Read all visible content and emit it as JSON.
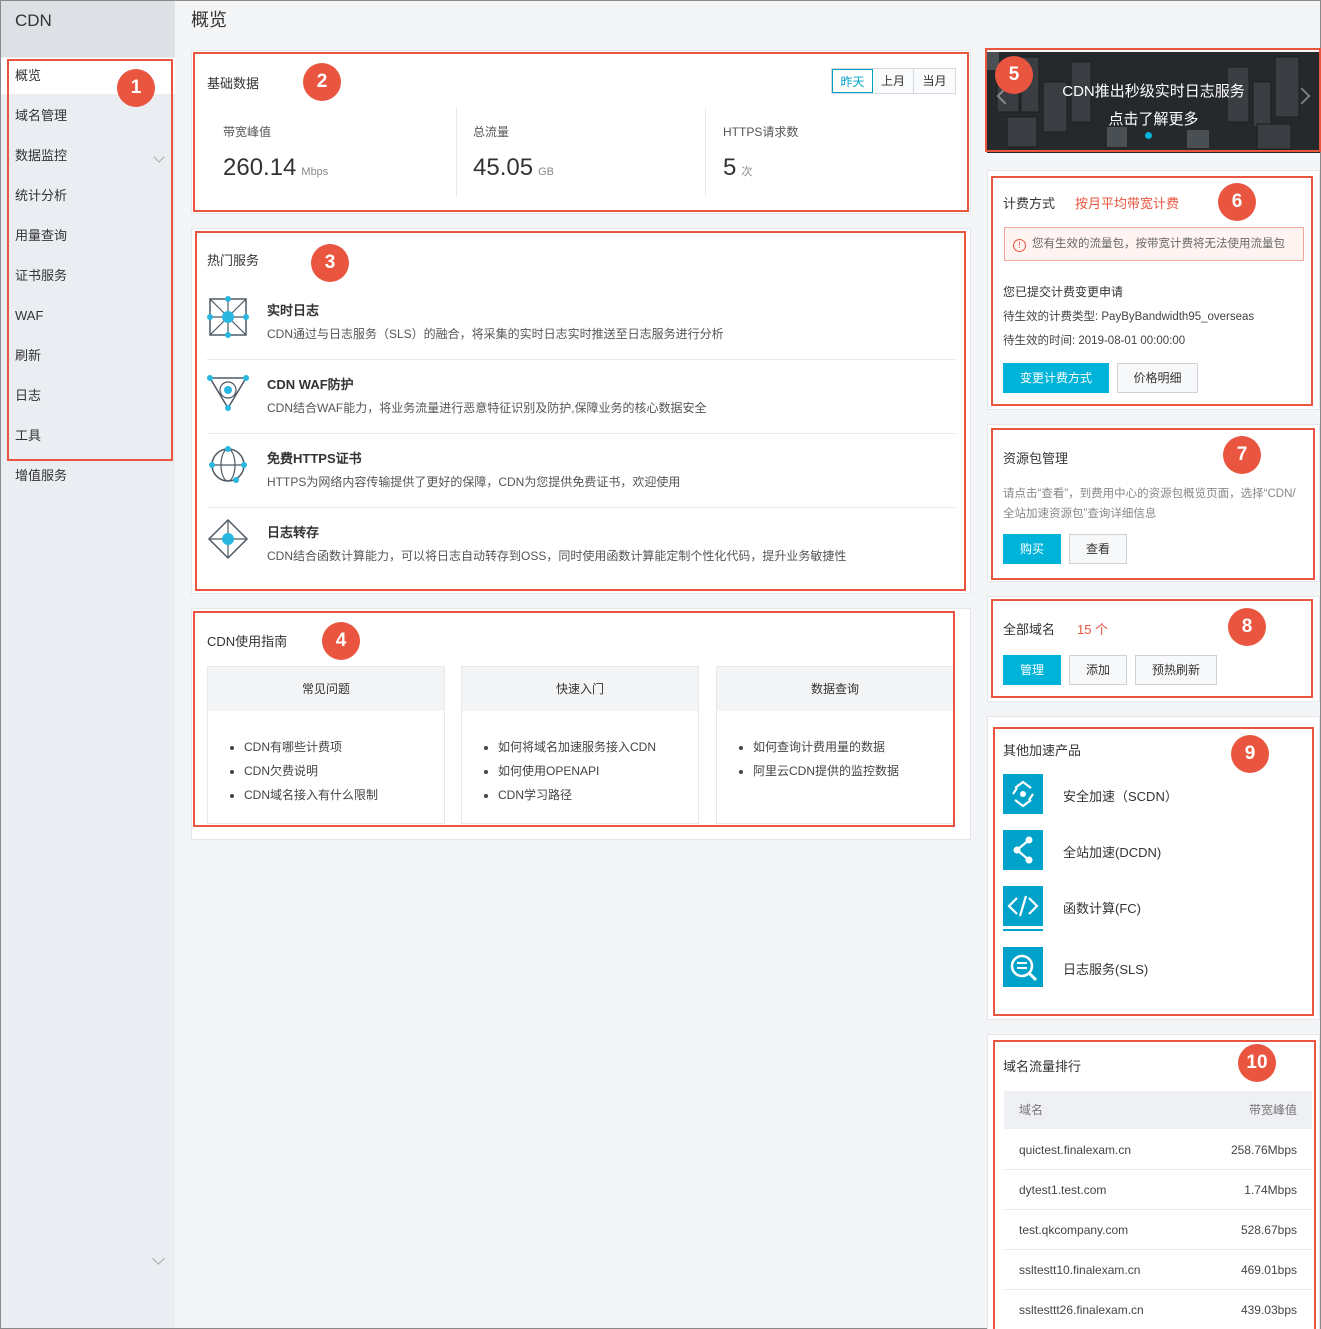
{
  "sidebar": {
    "title": "CDN",
    "items": [
      "概览",
      "域名管理",
      "数据监控",
      "统计分析",
      "用量查询",
      "证书服务",
      "WAF",
      "刷新",
      "日志",
      "工具",
      "增值服务"
    ]
  },
  "page_title": "概览",
  "basic_data": {
    "title": "基础数据",
    "range_options": [
      "昨天",
      "上月",
      "当月"
    ],
    "selected_range": "昨天",
    "stats": [
      {
        "label": "带宽峰值",
        "value": "260.14",
        "unit": "Mbps"
      },
      {
        "label": "总流量",
        "value": "45.05",
        "unit": "GB"
      },
      {
        "label": "HTTPS请求数",
        "value": "5",
        "unit": "次"
      }
    ]
  },
  "hot_services": {
    "title": "热门服务",
    "items": [
      {
        "title": "实时日志",
        "desc": "CDN通过与日志服务（SLS）的融合，将采集的实时日志实时推送至日志服务进行分析",
        "icon": "network-grid-icon"
      },
      {
        "title": "CDN WAF防护",
        "desc": "CDN结合WAF能力，将业务流量进行恶意特征识别及防护,保障业务的核心数据安全",
        "icon": "shield-triangle-icon"
      },
      {
        "title": "免费HTTPS证书",
        "desc": "HTTPS为网络内容传输提供了更好的保障，CDN为您提供免费证书，欢迎使用",
        "icon": "globe-nodes-icon"
      },
      {
        "title": "日志转存",
        "desc": "CDN结合函数计算能力，可以将日志自动转存到OSS，同时使用函数计算能定制个性化代码，提升业务敏捷性",
        "icon": "diamond-nodes-icon"
      }
    ]
  },
  "guide": {
    "title": "CDN使用指南",
    "columns": [
      {
        "header": "常见问题",
        "links": [
          "CDN有哪些计费项",
          "CDN欠费说明",
          "CDN域名接入有什么限制"
        ]
      },
      {
        "header": "快速入门",
        "links": [
          "如何将域名加速服务接入CDN",
          "如何使用OPENAPI",
          "CDN学习路径"
        ]
      },
      {
        "header": "数据查询",
        "links": [
          "如何查询计费用量的数据",
          "阿里云CDN提供的监控数据"
        ]
      }
    ]
  },
  "banner": {
    "line1": "CDN推出秒级实时日志服务",
    "line2": "点击了解更多"
  },
  "billing": {
    "label": "计费方式",
    "method": "按月平均带宽计费",
    "warning": "您有生效的流量包，按带宽计费将无法使用流量包",
    "submitted": "您已提交计费变更申请",
    "pending_type": "待生效的计费类型: PayByBandwidth95_overseas",
    "pending_time": "待生效的时间: 2019-08-01 00:00:00",
    "change_button": "变更计费方式",
    "price_button": "价格明细"
  },
  "resource_pkg": {
    "title": "资源包管理",
    "desc_line1": "请点击“查看”，到费用中心的资源包概览页面，选择“CDN/",
    "desc_line2": "全站加速资源包”查询详细信息",
    "buy_button": "购买",
    "view_button": "查看"
  },
  "domains": {
    "label": "全部域名",
    "count": "15 个",
    "manage_button": "管理",
    "add_button": "添加",
    "refresh_button": "预热刷新"
  },
  "other_products": {
    "title": "其他加速产品",
    "items": [
      {
        "name": "安全加速（SCDN）",
        "icon": "recycle-shield-icon"
      },
      {
        "name": "全站加速(DCDN)",
        "icon": "route-nodes-icon"
      },
      {
        "name": "函数计算(FC)",
        "icon": "code-brackets-icon"
      },
      {
        "name": "日志服务(SLS)",
        "icon": "log-search-icon"
      }
    ]
  },
  "ranking": {
    "title": "域名流量排行",
    "col_domain": "域名",
    "col_peak": "带宽峰值",
    "rows": [
      {
        "domain": "quictest.finalexam.cn",
        "peak": "258.76Mbps"
      },
      {
        "domain": "dytest1.test.com",
        "peak": "1.74Mbps"
      },
      {
        "domain": "test.qkcompany.com",
        "peak": "528.67bps"
      },
      {
        "domain": "ssltestt10.finalexam.cn",
        "peak": "469.01bps"
      },
      {
        "domain": "ssltesttt26.finalexam.cn",
        "peak": "439.03bps"
      }
    ]
  },
  "annotations": [
    "1",
    "2",
    "3",
    "4",
    "5",
    "6",
    "7",
    "8",
    "9",
    "10"
  ],
  "colors": {
    "accent": "#00b3d9",
    "annotation": "#e9553f",
    "sidebar_bg": "#eaedf1"
  }
}
